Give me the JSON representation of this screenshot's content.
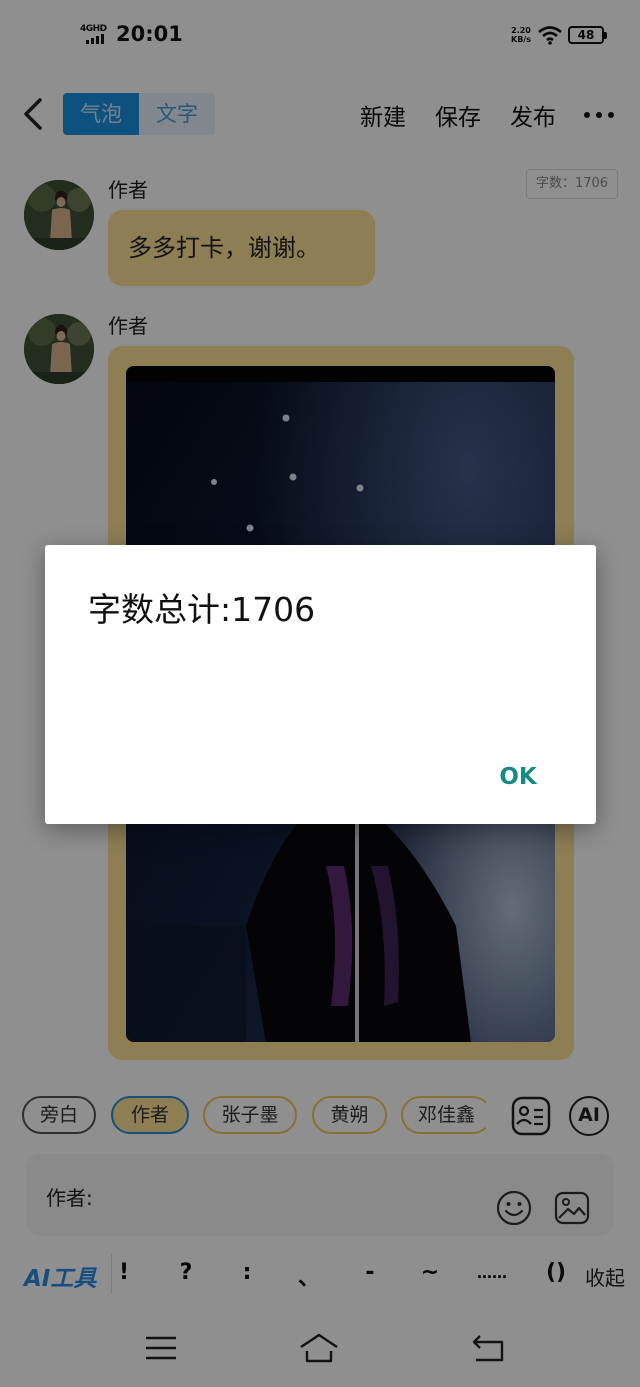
{
  "status_bar": {
    "network": "4GHD",
    "time": "20:01",
    "speed_value": "2.20",
    "speed_unit": "KB/s",
    "battery": "48"
  },
  "top_bar": {
    "tabs": [
      {
        "label": "气泡",
        "active": true
      },
      {
        "label": "文字",
        "active": false
      }
    ],
    "actions": {
      "new": "新建",
      "save": "保存",
      "publish": "发布"
    },
    "icons": [
      "back-arrow-icon",
      "more-dots-icon"
    ]
  },
  "chat": {
    "word_count_badge": "字数：1706",
    "messages": [
      {
        "author": "作者",
        "type": "text",
        "text": "多多打卡，谢谢。"
      },
      {
        "author": "作者",
        "type": "image"
      }
    ]
  },
  "role_chips": [
    {
      "label": "旁白",
      "style": "narration"
    },
    {
      "label": "作者",
      "style": "selected"
    },
    {
      "label": "张子墨",
      "style": "role"
    },
    {
      "label": "黄朔",
      "style": "role"
    },
    {
      "label": "邓佳鑫",
      "style": "role"
    }
  ],
  "role_tools": {
    "ai_label": "AI"
  },
  "input": {
    "prefix": "作者:"
  },
  "symbol_bar": {
    "ai_tools": "AI工具",
    "symbols": [
      "!",
      "?",
      ":",
      "、",
      "-",
      "~",
      "……",
      "()"
    ],
    "collapse": "收起"
  },
  "nav_bar": {
    "icons": [
      "menu-icon",
      "home-icon",
      "back-icon"
    ]
  },
  "dialog": {
    "message": "字数总计:1706",
    "ok_label": "OK"
  },
  "colors": {
    "bubble": "#fbe196",
    "accent_blue": "#1a91e3",
    "dialog_ok": "#148b84",
    "scrim": "rgba(0,0,0,0.44)"
  }
}
